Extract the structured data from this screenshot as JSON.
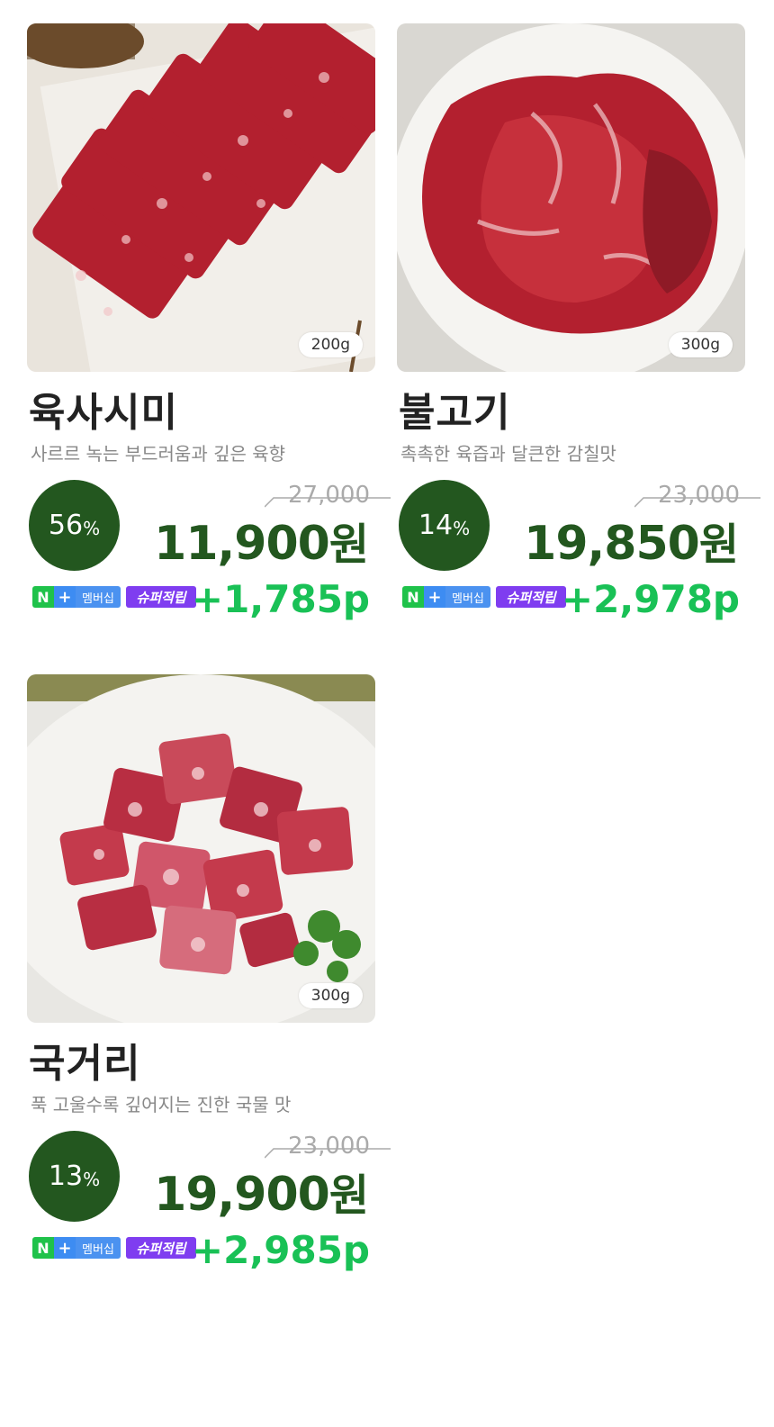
{
  "products": [
    {
      "name": "육사시미",
      "description": "사르르 녹는 부드러움과 깊은 육향",
      "weight": "200g",
      "discount": "56",
      "discount_unit": "%",
      "original_price": "27,000",
      "final_price": "11,900",
      "currency": "원",
      "points": "+1,785p",
      "badge_n": "N",
      "badge_plus": "+",
      "badge_member": "멤버십",
      "badge_super": "슈퍼적립"
    },
    {
      "name": "불고기",
      "description": "촉촉한 육즙과 달큰한 감칠맛",
      "weight": "300g",
      "discount": "14",
      "discount_unit": "%",
      "original_price": "23,000",
      "final_price": "19,850",
      "currency": "원",
      "points": "+2,978p",
      "badge_n": "N",
      "badge_plus": "+",
      "badge_member": "멤버십",
      "badge_super": "슈퍼적립"
    },
    {
      "name": "국거리",
      "description": "푹 고울수록 깊어지는 진한 국물 맛",
      "weight": "300g",
      "discount": "13",
      "discount_unit": "%",
      "original_price": "23,000",
      "final_price": "19,900",
      "currency": "원",
      "points": "+2,985p",
      "badge_n": "N",
      "badge_plus": "+",
      "badge_member": "멤버십",
      "badge_super": "슈퍼적립"
    }
  ],
  "colors": {
    "discount_bg": "#23571f",
    "price": "#23571f",
    "points": "#19c156",
    "badge_n_green": "#1fc24a",
    "badge_blue": "#4b92f0",
    "badge_super": "#7f3df0"
  }
}
